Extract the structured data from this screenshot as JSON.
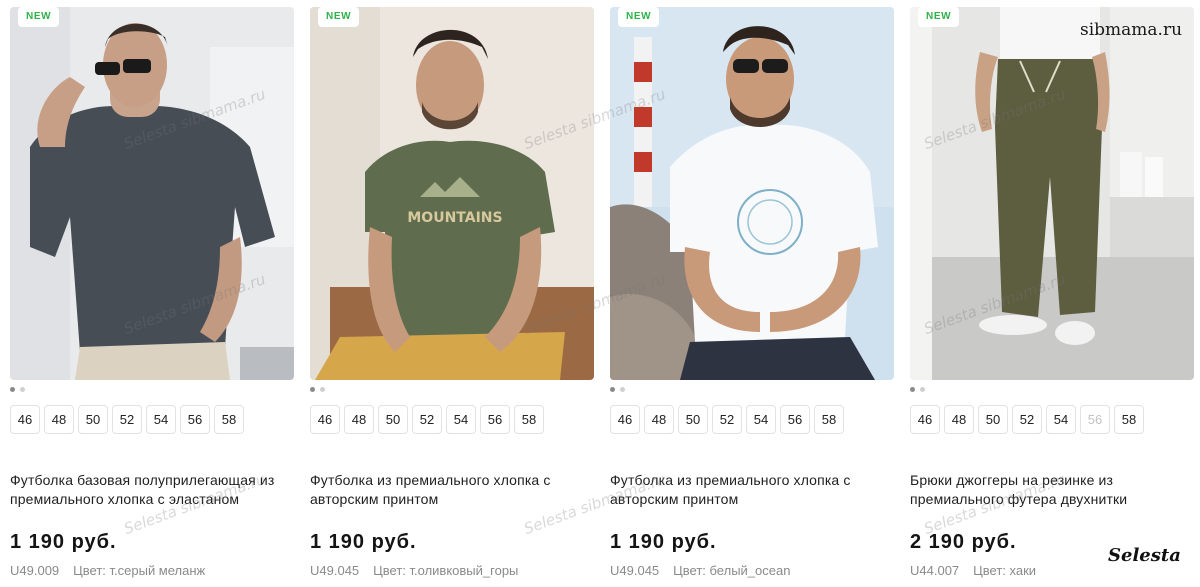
{
  "products": [
    {
      "badge": "NEW",
      "sizes": [
        "46",
        "48",
        "50",
        "52",
        "54",
        "56",
        "58"
      ],
      "title_line1": "Футболка базовая полуприлегающая из",
      "title_line2": "премиального хлопка с эластаном",
      "price": "1 190 руб.",
      "sku": "U49.009",
      "color": "Цвет: т.серый меланж"
    },
    {
      "badge": "NEW",
      "sizes": [
        "46",
        "48",
        "50",
        "52",
        "54",
        "56",
        "58"
      ],
      "title_line1": "Футболка из премиального хлопка с",
      "title_line2": "авторским принтом",
      "price": "1 190 руб.",
      "sku": "U49.045",
      "color": "Цвет: т.оливковый_горы"
    },
    {
      "badge": "NEW",
      "sizes": [
        "46",
        "48",
        "50",
        "52",
        "54",
        "56",
        "58"
      ],
      "title_line1": "Футболка из премиального хлопка с",
      "title_line2": "авторским принтом",
      "price": "1 190 руб.",
      "sku": "U49.045",
      "color": "Цвет: белый_ocean"
    },
    {
      "badge": "NEW",
      "sizes": [
        "46",
        "48",
        "50",
        "52",
        "54",
        "56",
        "58"
      ],
      "title_line1": "Брюки джоггеры на резинке из",
      "title_line2": "премиального футера двухнитки",
      "price": "2 190 руб.",
      "sku": "U44.007",
      "color": "Цвет: хаки"
    }
  ],
  "watermarks": {
    "top_right": "sibmama.ru",
    "bottom_right": "Selesta",
    "faint": "Selesta sibmama.ru"
  }
}
